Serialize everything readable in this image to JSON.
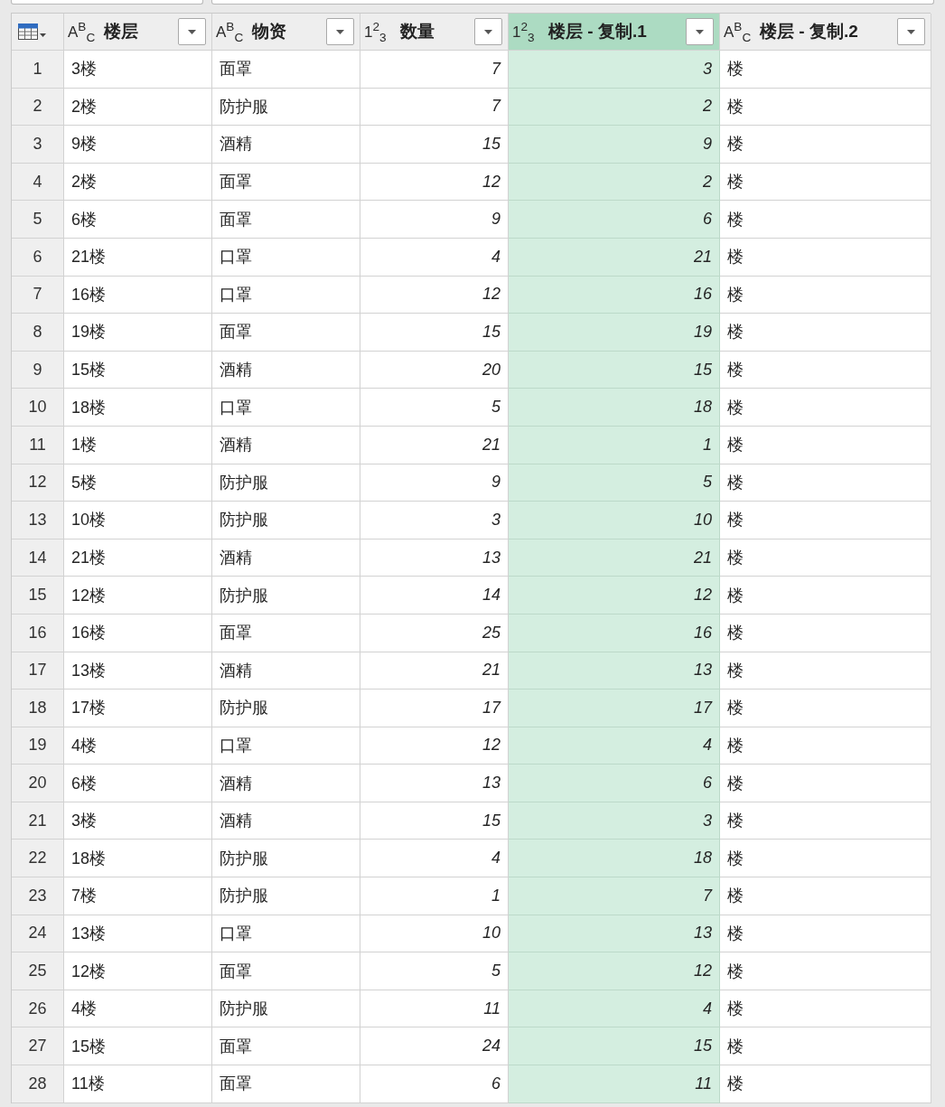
{
  "table": {
    "columns": [
      {
        "type_label": "A$^{B}$$_{C}$",
        "name": "楼层",
        "kind": "text",
        "selected": false
      },
      {
        "type_label": "A$^{B}$$_{C}$",
        "name": "物资",
        "kind": "text",
        "selected": false
      },
      {
        "type_label": "1$^{2}$$_{3}$",
        "name": "数量",
        "kind": "number",
        "selected": false
      },
      {
        "type_label": "1$^{2}$$_{3}$",
        "name": "楼层 - 复制.1",
        "kind": "number",
        "selected": true
      },
      {
        "type_label": "A$^{B}$$_{C}$",
        "name": "楼层 - 复制.2",
        "kind": "text",
        "selected": false
      }
    ],
    "rows": [
      {
        "number": "1",
        "cells": [
          "3楼",
          "面罩",
          "7",
          "3",
          "楼"
        ]
      },
      {
        "number": "2",
        "cells": [
          "2楼",
          "防护服",
          "7",
          "2",
          "楼"
        ]
      },
      {
        "number": "3",
        "cells": [
          "9楼",
          "酒精",
          "15",
          "9",
          "楼"
        ]
      },
      {
        "number": "4",
        "cells": [
          "2楼",
          "面罩",
          "12",
          "2",
          "楼"
        ]
      },
      {
        "number": "5",
        "cells": [
          "6楼",
          "面罩",
          "9",
          "6",
          "楼"
        ]
      },
      {
        "number": "6",
        "cells": [
          "21楼",
          "口罩",
          "4",
          "21",
          "楼"
        ]
      },
      {
        "number": "7",
        "cells": [
          "16楼",
          "口罩",
          "12",
          "16",
          "楼"
        ]
      },
      {
        "number": "8",
        "cells": [
          "19楼",
          "面罩",
          "15",
          "19",
          "楼"
        ]
      },
      {
        "number": "9",
        "cells": [
          "15楼",
          "酒精",
          "20",
          "15",
          "楼"
        ]
      },
      {
        "number": "10",
        "cells": [
          "18楼",
          "口罩",
          "5",
          "18",
          "楼"
        ]
      },
      {
        "number": "11",
        "cells": [
          "1楼",
          "酒精",
          "21",
          "1",
          "楼"
        ]
      },
      {
        "number": "12",
        "cells": [
          "5楼",
          "防护服",
          "9",
          "5",
          "楼"
        ]
      },
      {
        "number": "13",
        "cells": [
          "10楼",
          "防护服",
          "3",
          "10",
          "楼"
        ]
      },
      {
        "number": "14",
        "cells": [
          "21楼",
          "酒精",
          "13",
          "21",
          "楼"
        ]
      },
      {
        "number": "15",
        "cells": [
          "12楼",
          "防护服",
          "14",
          "12",
          "楼"
        ]
      },
      {
        "number": "16",
        "cells": [
          "16楼",
          "面罩",
          "25",
          "16",
          "楼"
        ]
      },
      {
        "number": "17",
        "cells": [
          "13楼",
          "酒精",
          "21",
          "13",
          "楼"
        ]
      },
      {
        "number": "18",
        "cells": [
          "17楼",
          "防护服",
          "17",
          "17",
          "楼"
        ]
      },
      {
        "number": "19",
        "cells": [
          "4楼",
          "口罩",
          "12",
          "4",
          "楼"
        ]
      },
      {
        "number": "20",
        "cells": [
          "6楼",
          "酒精",
          "13",
          "6",
          "楼"
        ]
      },
      {
        "number": "21",
        "cells": [
          "3楼",
          "酒精",
          "15",
          "3",
          "楼"
        ]
      },
      {
        "number": "22",
        "cells": [
          "18楼",
          "防护服",
          "4",
          "18",
          "楼"
        ]
      },
      {
        "number": "23",
        "cells": [
          "7楼",
          "防护服",
          "1",
          "7",
          "楼"
        ]
      },
      {
        "number": "24",
        "cells": [
          "13楼",
          "口罩",
          "10",
          "13",
          "楼"
        ]
      },
      {
        "number": "25",
        "cells": [
          "12楼",
          "面罩",
          "5",
          "12",
          "楼"
        ]
      },
      {
        "number": "26",
        "cells": [
          "4楼",
          "防护服",
          "11",
          "4",
          "楼"
        ]
      },
      {
        "number": "27",
        "cells": [
          "15楼",
          "面罩",
          "24",
          "15",
          "楼"
        ]
      },
      {
        "number": "28",
        "cells": [
          "11楼",
          "面罩",
          "6",
          "11",
          "楼"
        ]
      }
    ]
  }
}
